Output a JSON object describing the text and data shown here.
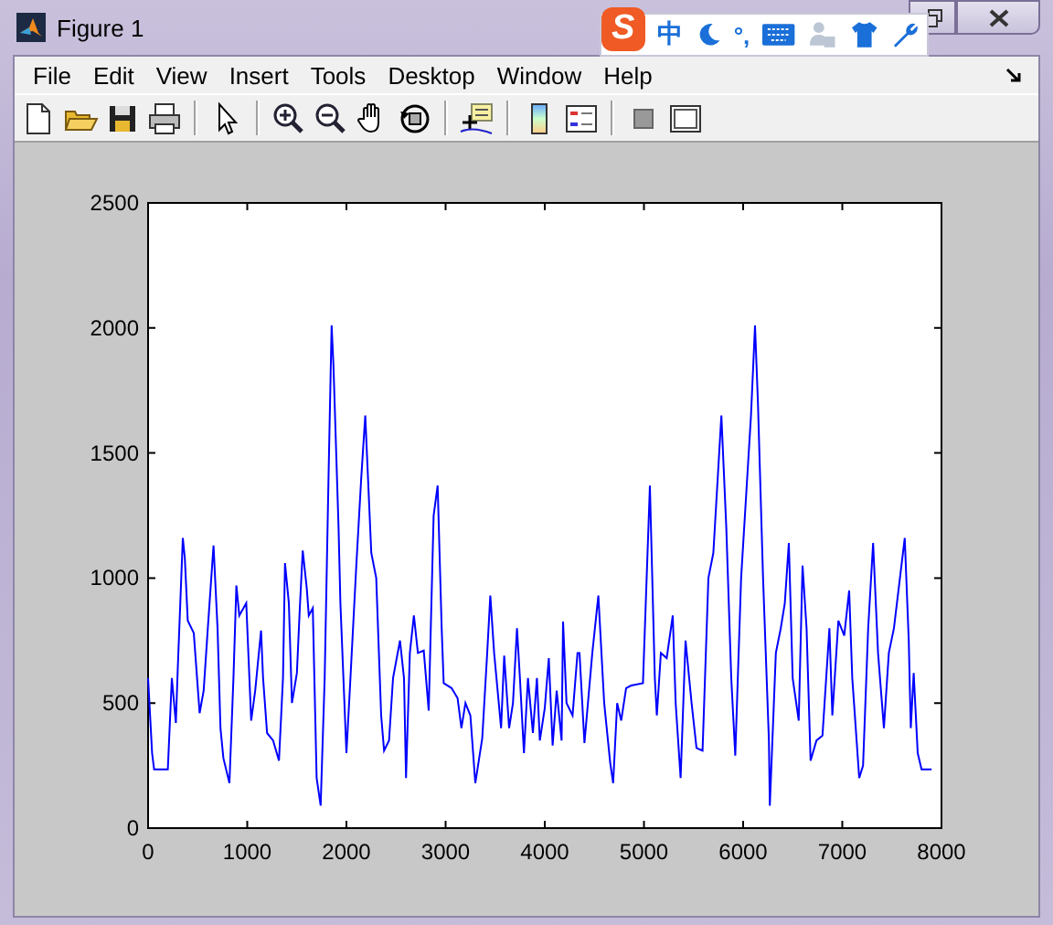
{
  "window": {
    "title": "Figure 1"
  },
  "ime_bar": {
    "logo": "S",
    "mode": "中",
    "punctuation": "°,"
  },
  "menu": [
    "File",
    "Edit",
    "View",
    "Insert",
    "Tools",
    "Desktop",
    "Window",
    "Help"
  ],
  "figure": {
    "chart_data": {
      "type": "line",
      "x": [
        0,
        40,
        60,
        200,
        240,
        280,
        300,
        350,
        370,
        400,
        460,
        520,
        560,
        600,
        660,
        700,
        730,
        760,
        820,
        860,
        890,
        920,
        990,
        1040,
        1080,
        1140,
        1160,
        1200,
        1260,
        1320,
        1360,
        1380,
        1420,
        1450,
        1500,
        1530,
        1560,
        1600,
        1620,
        1660,
        1700,
        1740,
        1780,
        1820,
        1850,
        1870,
        1920,
        1940,
        2000,
        2040,
        2100,
        2150,
        2190,
        2250,
        2300,
        2350,
        2380,
        2430,
        2470,
        2540,
        2580,
        2600,
        2640,
        2680,
        2720,
        2780,
        2830,
        2880,
        2920,
        2960,
        2980,
        3060,
        3120,
        3160,
        3200,
        3250,
        3300,
        3370,
        3420,
        3450,
        3490,
        3560,
        3590,
        3640,
        3680,
        3720,
        3750,
        3790,
        3830,
        3880,
        3920,
        3950,
        4000,
        4040,
        4080,
        4120,
        4170,
        4185,
        4220,
        4280,
        4330,
        4350,
        4400,
        4480,
        4540,
        4600,
        4660,
        4690,
        4730,
        4770,
        4820,
        4870,
        4990,
        5060,
        5110,
        5130,
        5170,
        5230,
        5290,
        5320,
        5370,
        5420,
        5480,
        5530,
        5590,
        5650,
        5700,
        5780,
        5830,
        5880,
        5920,
        5980,
        6080,
        6120,
        6150,
        6200,
        6260,
        6270,
        6330,
        6380,
        6420,
        6460,
        6500,
        6560,
        6600,
        6640,
        6680,
        6740,
        6800,
        6870,
        6900,
        6960,
        7020,
        7070,
        7100,
        7170,
        7210,
        7260,
        7310,
        7360,
        7420,
        7470,
        7520,
        7630,
        7670,
        7690,
        7720,
        7760,
        7800,
        7900
      ],
      "series": [
        {
          "color": "#0000ff",
          "values": [
            600,
            300,
            235,
            235,
            600,
            420,
            650,
            1160,
            1080,
            830,
            780,
            460,
            550,
            780,
            1130,
            800,
            400,
            280,
            180,
            600,
            970,
            850,
            900,
            430,
            550,
            790,
            600,
            380,
            350,
            270,
            600,
            1060,
            900,
            500,
            620,
            880,
            1110,
            960,
            850,
            880,
            200,
            90,
            600,
            1400,
            2010,
            1850,
            1200,
            900,
            300,
            600,
            1050,
            1400,
            1650,
            1100,
            1000,
            450,
            310,
            350,
            600,
            750,
            600,
            200,
            700,
            850,
            700,
            710,
            470,
            1250,
            1370,
            800,
            580,
            560,
            520,
            400,
            500,
            450,
            180,
            360,
            700,
            930,
            700,
            400,
            690,
            400,
            500,
            800,
            600,
            300,
            600,
            380,
            600,
            350,
            480,
            680,
            330,
            550,
            350,
            826,
            500,
            450,
            700,
            700,
            340,
            700,
            930,
            500,
            260,
            180,
            500,
            430,
            560,
            570,
            580,
            1370,
            600,
            450,
            700,
            680,
            850,
            500,
            200,
            750,
            500,
            320,
            310,
            1000,
            1100,
            1650,
            1200,
            600,
            290,
            1000,
            1650,
            2010,
            1700,
            1000,
            350,
            90,
            700,
            800,
            900,
            1140,
            600,
            430,
            1050,
            800,
            270,
            350,
            370,
            800,
            450,
            830,
            770,
            950,
            600,
            200,
            250,
            800,
            1140,
            700,
            400,
            700,
            800,
            1160,
            750,
            400,
            620,
            300,
            235,
            235
          ]
        }
      ],
      "xlim": [
        0,
        8000
      ],
      "ylim": [
        0,
        2500
      ],
      "xticks": [
        0,
        1000,
        2000,
        3000,
        4000,
        5000,
        6000,
        7000,
        8000
      ],
      "yticks": [
        0,
        500,
        1000,
        1500,
        2000,
        2500
      ]
    }
  }
}
